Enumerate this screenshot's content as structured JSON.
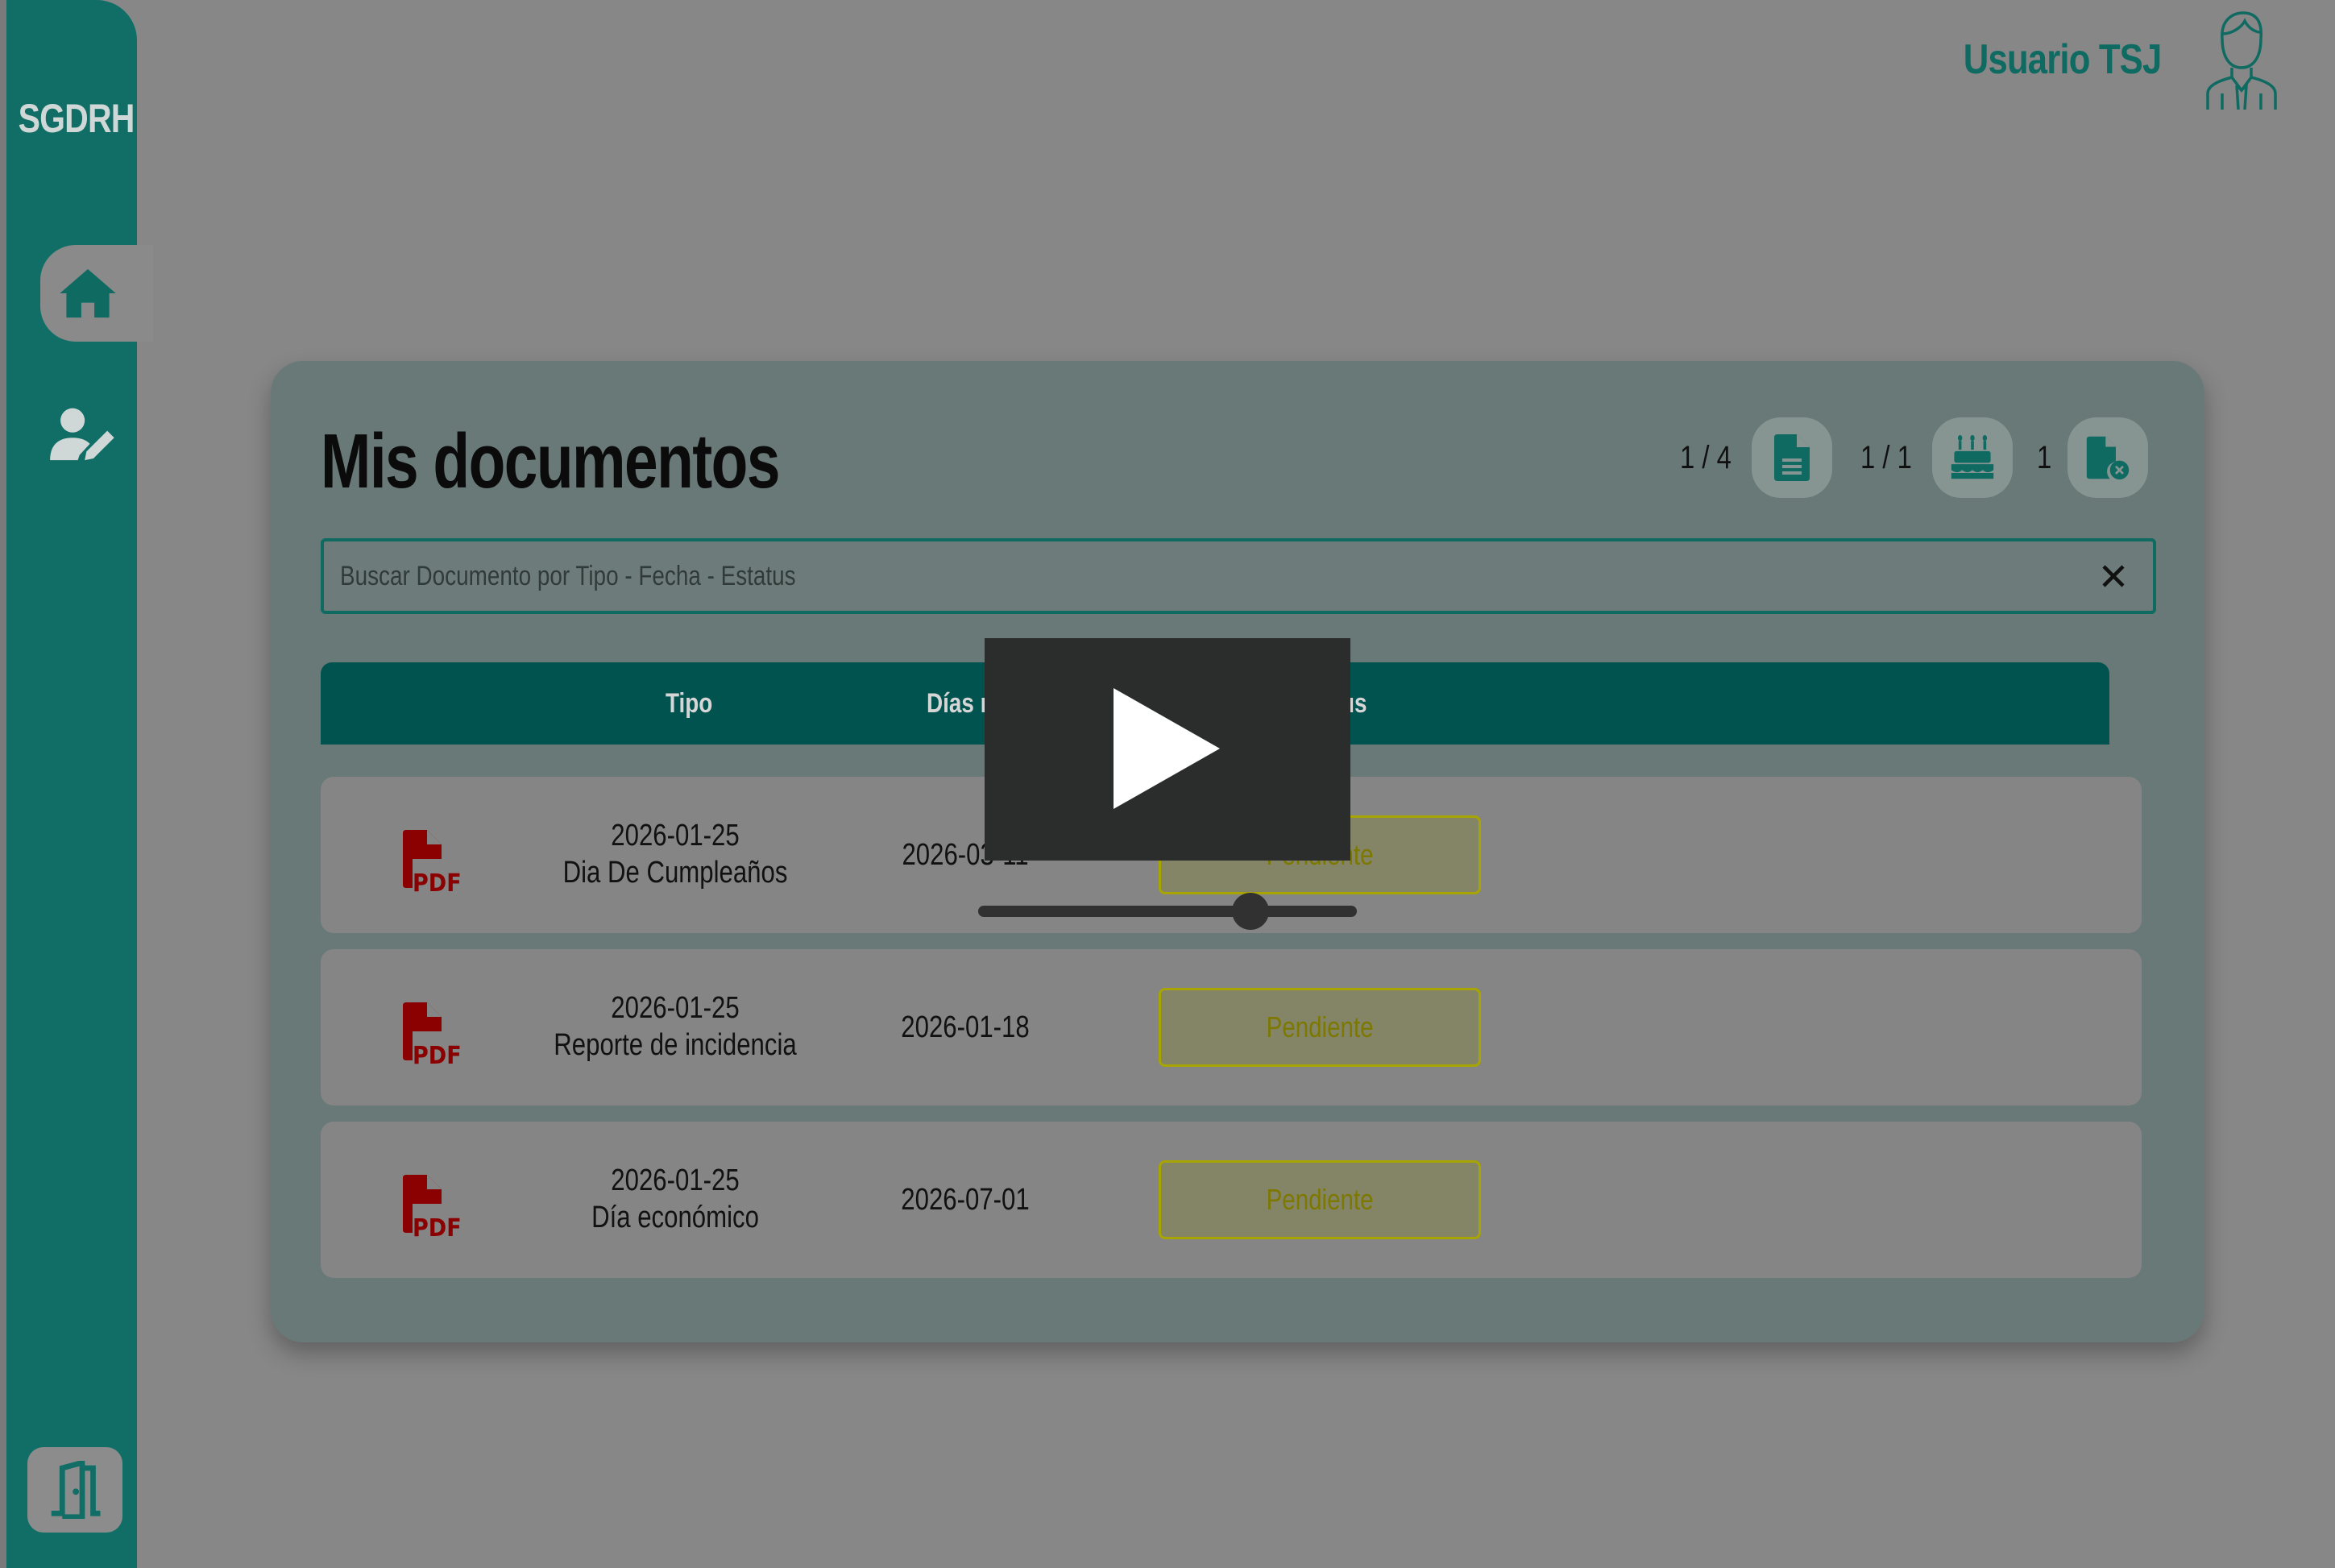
{
  "app": {
    "brand": "SGDRH"
  },
  "header": {
    "user_name": "Usuario TSJ"
  },
  "sidebar": {
    "items": [
      {
        "icon": "home-icon",
        "active": true
      },
      {
        "icon": "user-edit-icon",
        "active": false
      }
    ],
    "logout_icon": "door-exit-icon"
  },
  "main": {
    "title": "Mis documentos",
    "counters": [
      {
        "value": "1 / 4",
        "icon": "document-icon"
      },
      {
        "value": "1 / 1",
        "icon": "birthday-cake-icon"
      },
      {
        "value": "1",
        "icon": "file-cancel-icon"
      }
    ],
    "search": {
      "placeholder": "Buscar Documento por Tipo - Fecha - Estatus",
      "value": ""
    },
    "table": {
      "columns": [
        "Tipo",
        "Días r",
        "us"
      ],
      "rows": [
        {
          "date": "2026-01-25",
          "type": "Dia De Cumpleaños",
          "days": "2026-03-11",
          "status": "Pendiente"
        },
        {
          "date": "2026-01-25",
          "type": "Reporte de incidencia",
          "days": "2026-01-18",
          "status": "Pendiente"
        },
        {
          "date": "2026-01-25",
          "type": "Día económico",
          "days": "2026-07-01",
          "status": "Pendiente"
        }
      ]
    }
  },
  "video": {
    "progress": 0.72
  },
  "colors": {
    "accent": "#116e66",
    "header_bar": "#015350",
    "pdf": "#8b0000",
    "status_border": "#a8a400"
  }
}
